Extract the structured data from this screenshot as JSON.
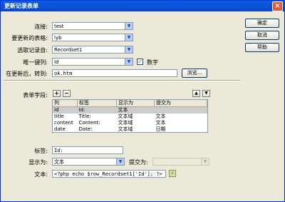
{
  "title": "更新记录表单",
  "buttons": {
    "ok": "确定",
    "cancel": "取消",
    "help": "帮助",
    "browse": "浏览...",
    "add": "+",
    "remove": "−",
    "up": "▲",
    "down": "▼"
  },
  "connection": {
    "label": "连接:",
    "value": "test"
  },
  "table": {
    "label": "要更新的表格:",
    "value": "lyb"
  },
  "recordset": {
    "label": "选取记录自:",
    "value": "Recordset1"
  },
  "key_column": {
    "label": "唯一键列:",
    "value": "Id",
    "numeric_label": "数字",
    "numeric_checked": true
  },
  "redirect": {
    "label": "在更新后，转到:",
    "value": "ok.htm"
  },
  "form_fields": {
    "label": "表单字段:",
    "headers": [
      "列",
      "标签",
      "显示为",
      "提交为"
    ],
    "rows": [
      [
        "Id",
        "Id:",
        "文本",
        ""
      ],
      [
        "title",
        "Title:",
        "文本域",
        "文本"
      ],
      [
        "content",
        "Content:",
        "文本域",
        "文本"
      ],
      [
        "date",
        "Date:",
        "文本域",
        "日期"
      ]
    ]
  },
  "field_label": {
    "label": "标签:",
    "value": "Id:"
  },
  "display_as": {
    "label": "显示为:",
    "value": "文本"
  },
  "submit_as": {
    "label": "提交为:",
    "value": ""
  },
  "text": {
    "label": "文本:",
    "value": "<?php echo $row_Recordset1['Id']; ?>"
  }
}
